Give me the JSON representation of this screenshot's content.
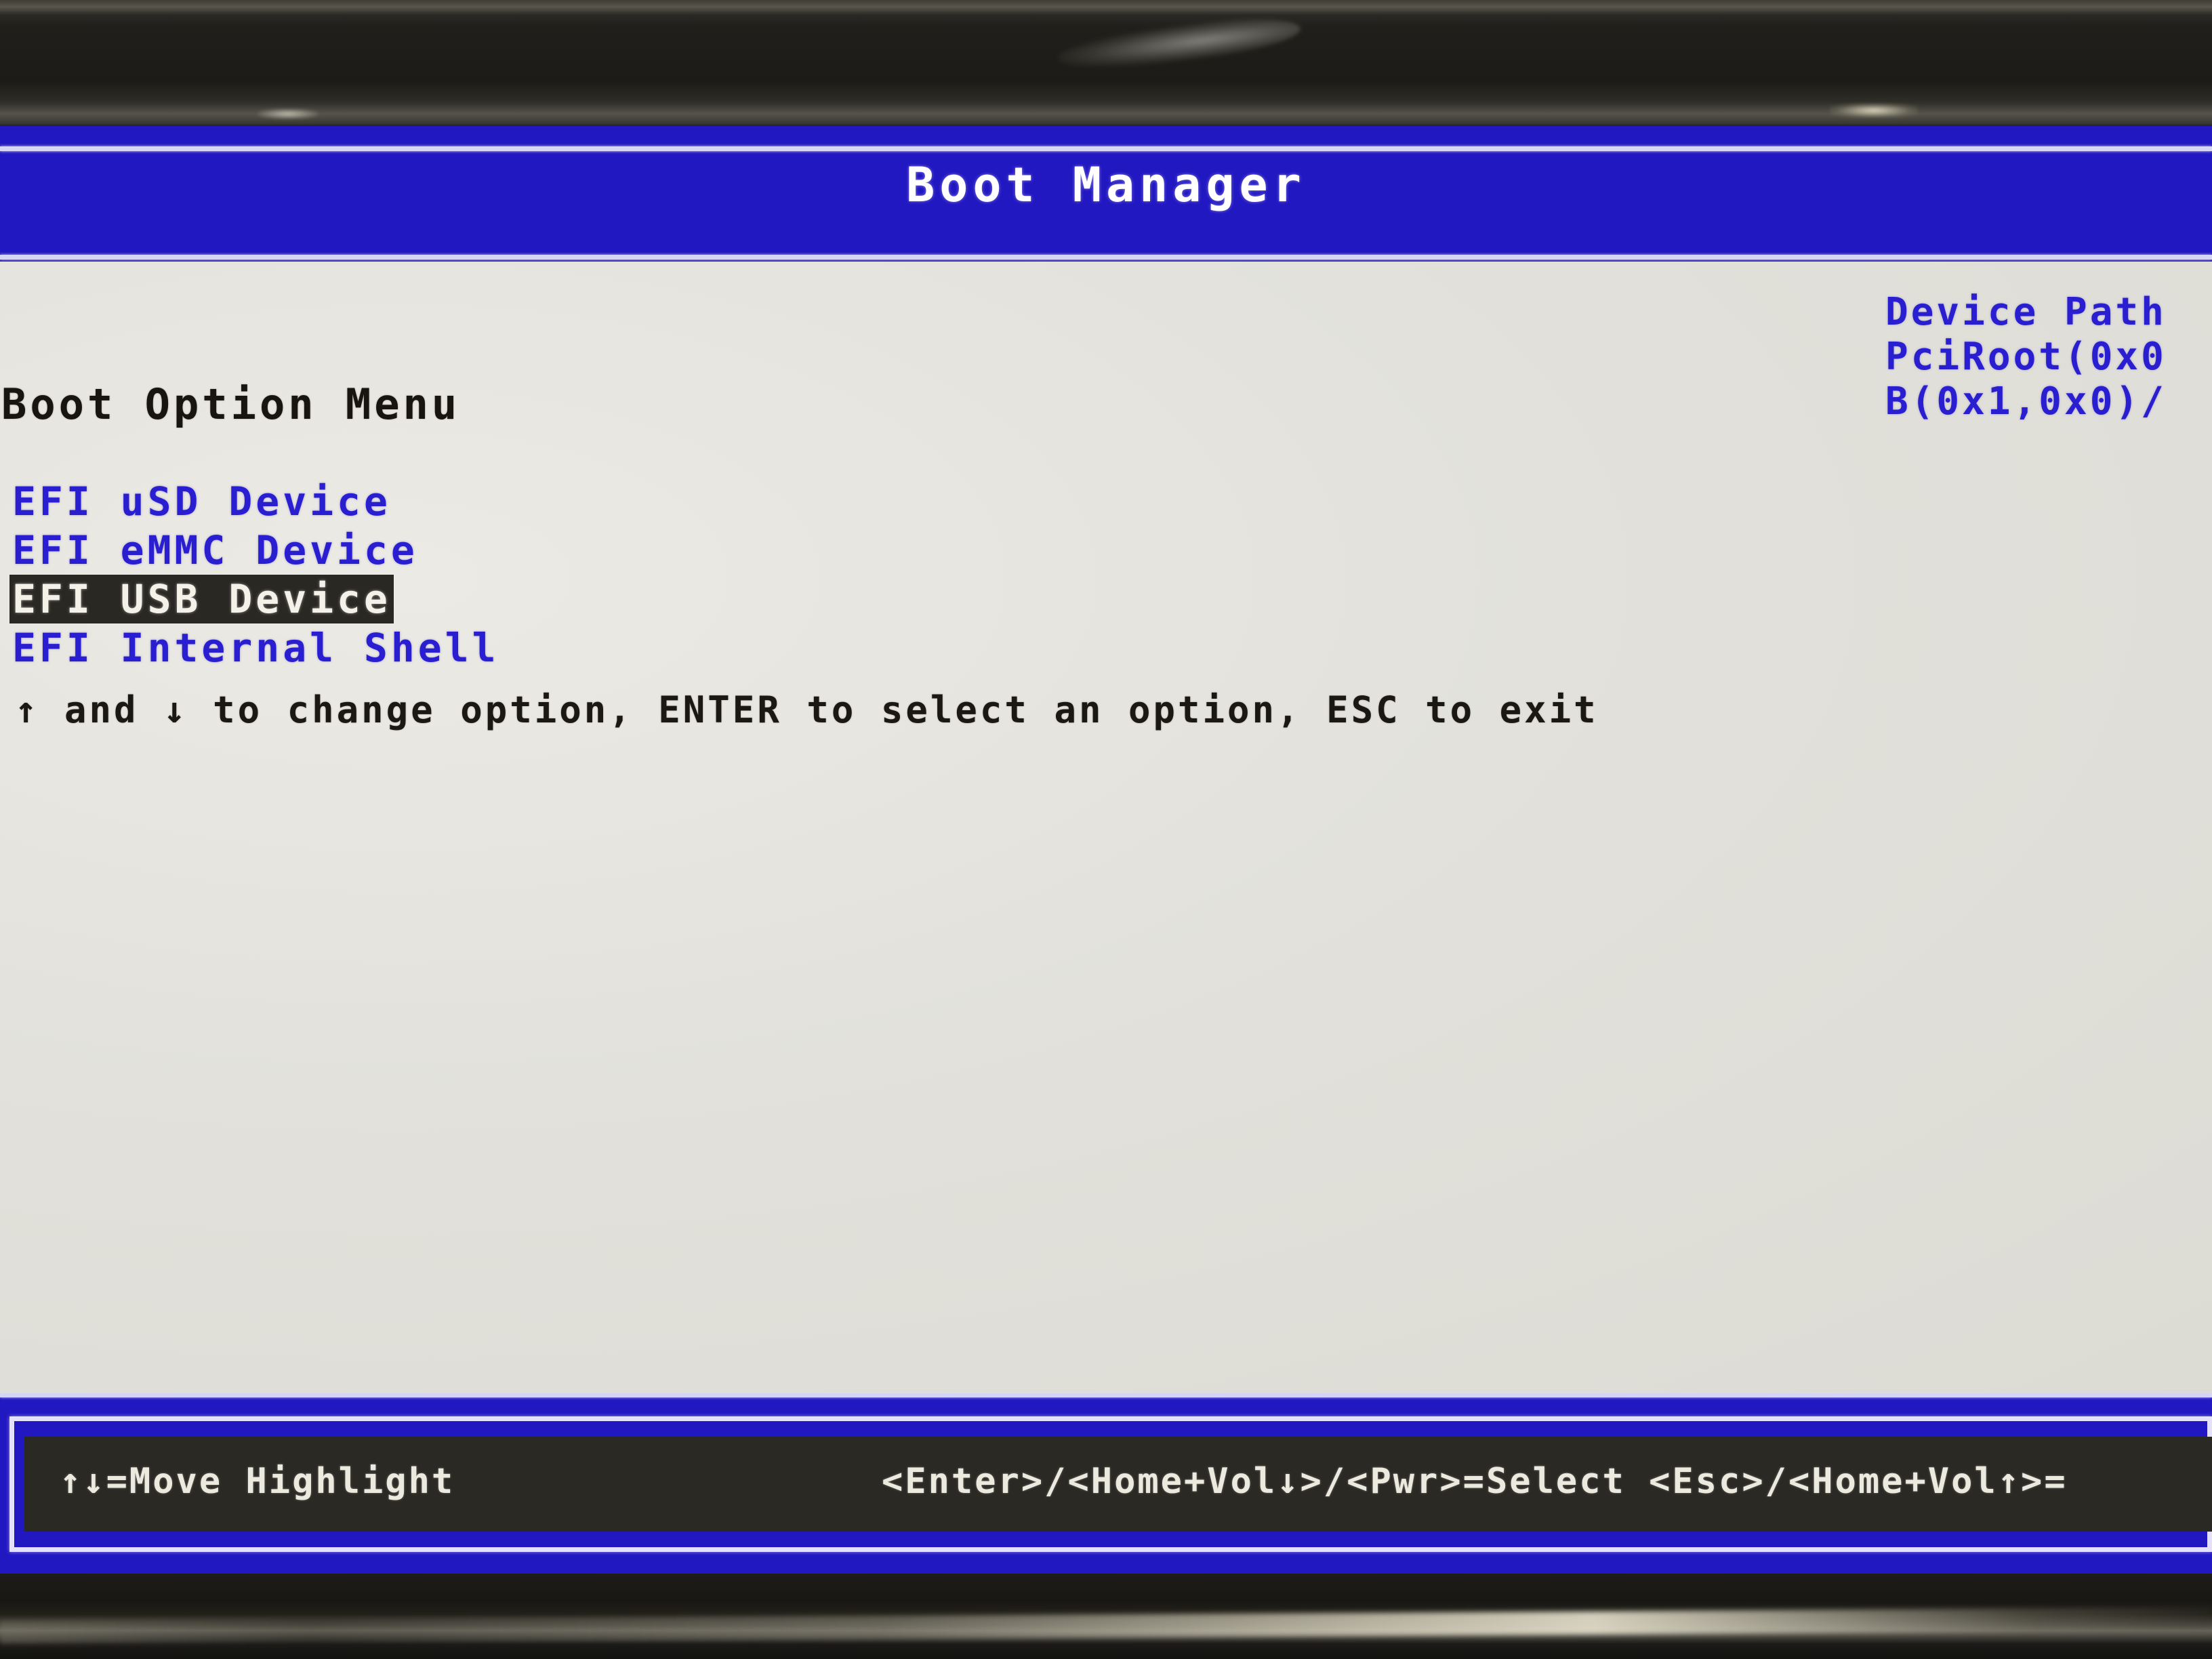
{
  "screen": {
    "title": "Boot Manager",
    "background_color": "#e5e4df",
    "accent_color": "#2218c2",
    "text_color": "#2a1fd0",
    "highlight_bg": "#2a2823",
    "highlight_fg": "#f3f1e8"
  },
  "menu": {
    "heading": "Boot Option Menu",
    "options": [
      {
        "label": "EFI uSD Device",
        "selected": false
      },
      {
        "label": "EFI eMMC Device",
        "selected": false
      },
      {
        "label": "EFI USB Device",
        "selected": true
      },
      {
        "label": "EFI Internal Shell",
        "selected": false
      }
    ],
    "hint": "↑ and ↓ to change option, ENTER to select an option, ESC to exit"
  },
  "device_path": {
    "heading": "Device Path",
    "lines": [
      "PciRoot(0x0",
      "B(0x1,0x0)/"
    ]
  },
  "status_bar": {
    "left": "↑↓=Move Highlight",
    "right": "<Enter>/<Home+Vol↓>/<Pwr>=Select  <Esc>/<Home+Vol↑>="
  }
}
